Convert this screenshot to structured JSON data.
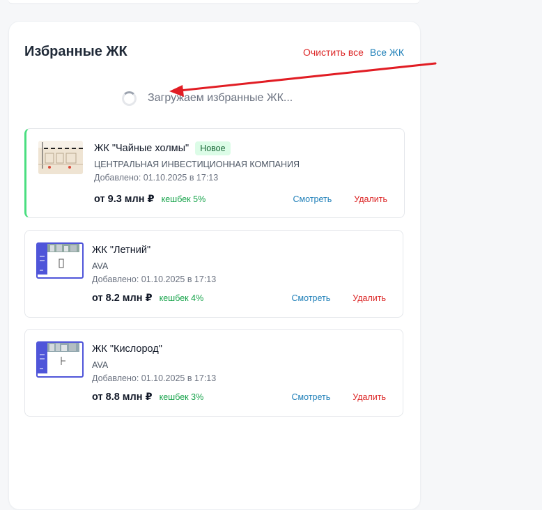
{
  "favorites": {
    "title": "Избранные ЖК",
    "clear_all_label": "Очистить все",
    "all_label": "Все ЖК",
    "loading_text": "Загружаем избранные ЖК..."
  },
  "cards": [
    {
      "name": "ЖК \"Чайные холмы\"",
      "badge": "Новое",
      "developer": "ЦЕНТРАЛЬНАЯ ИНВЕСТИЦИОННАЯ КОМПАНИЯ",
      "added": "Добавлено: 01.10.2025 в 17:13",
      "price": "от 9.3 млн ₽",
      "cashback": "кешбек 5%",
      "view_label": "Смотреть",
      "delete_label": "Удалить"
    },
    {
      "name": "ЖК \"Летний\"",
      "developer": "AVA",
      "added": "Добавлено: 01.10.2025 в 17:13",
      "price": "от 8.2 млн ₽",
      "cashback": "кешбек 4%",
      "view_label": "Смотреть",
      "delete_label": "Удалить"
    },
    {
      "name": "ЖК \"Кислород\"",
      "developer": "AVA",
      "added": "Добавлено: 01.10.2025 в 17:13",
      "price": "от 8.8 млн ₽",
      "cashback": "кешбек 3%",
      "view_label": "Смотреть",
      "delete_label": "Удалить"
    }
  ],
  "colors": {
    "accent_blue": "#1e7fb8",
    "danger_red": "#dc2626",
    "cashback_green": "#16a34a",
    "new_badge_bg": "#dcfce7",
    "highlight_border": "#4ade80",
    "thumbnail_frame": "#4f55d9",
    "annotation_arrow": "#e11d24"
  },
  "icons": {
    "loading": "spinner-icon",
    "annotation": "arrow-annotation-icon"
  }
}
